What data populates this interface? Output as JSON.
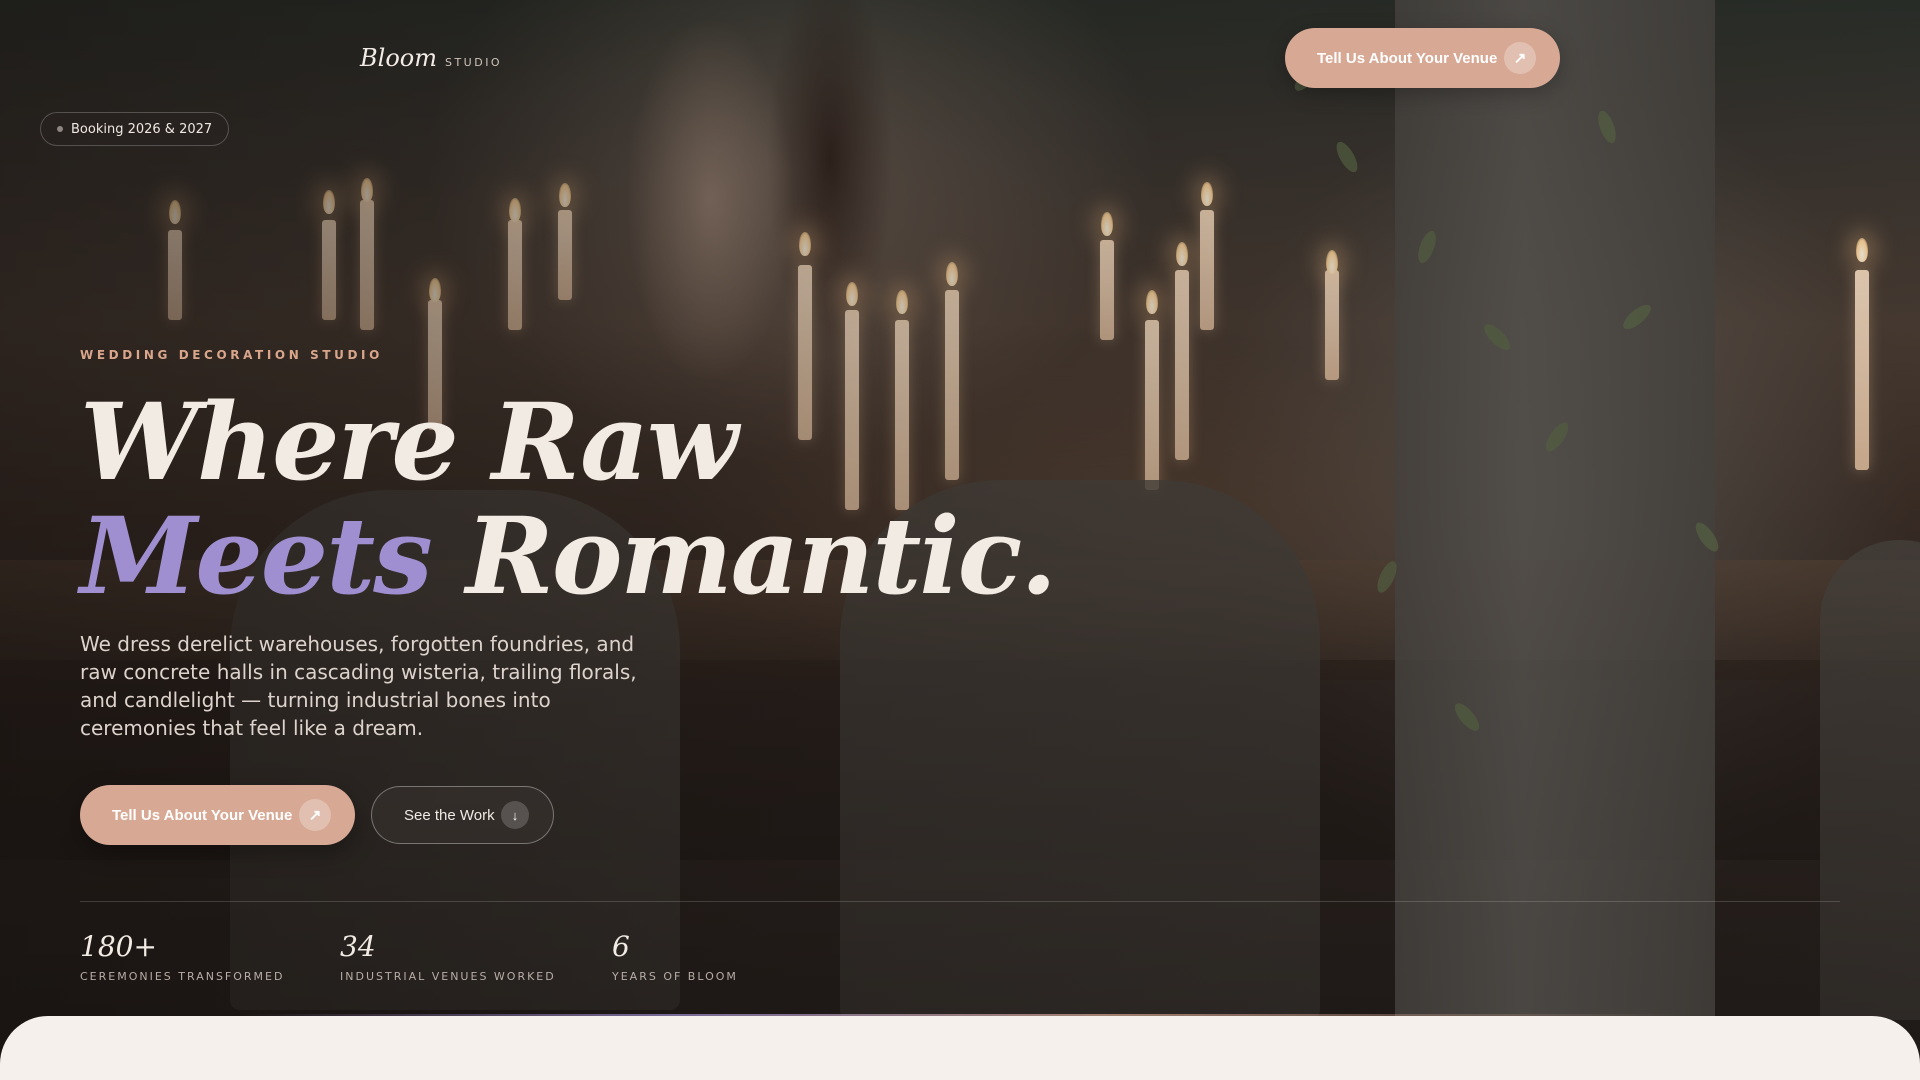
{
  "brand": {
    "name": "Bloom",
    "tag": "STUDIO"
  },
  "nav": {
    "cta_label": "Tell Us About Your Venue",
    "cta_icon": "arrow-up-right-icon"
  },
  "booking_badge": {
    "label": "Booking 2026 & 2027"
  },
  "hero": {
    "eyebrow": "WEDDING DECORATION STUDIO",
    "headline_line1": "Where Raw",
    "headline_accent": "Meets",
    "headline_line2_rest": " Romantic.",
    "lede": "We dress derelict warehouses, forgotten foundries, and raw concrete halls in cascading wisteria, trailing florals, and candlelight — turning industrial bones into ceremonies that feel like a dream.",
    "primary_cta": "Tell Us About Your Venue",
    "secondary_cta": "See the Work"
  },
  "stats": [
    {
      "value": "180+",
      "label": "CEREMONIES TRANSFORMED"
    },
    {
      "value": "34",
      "label": "INDUSTRIAL VENUES WORKED"
    },
    {
      "value": "6",
      "label": "YEARS OF BLOOM"
    }
  ],
  "colors": {
    "accent_peach": "#d7a893",
    "accent_lavender": "#9f8fd0",
    "sheet": "#f5f0ec"
  }
}
